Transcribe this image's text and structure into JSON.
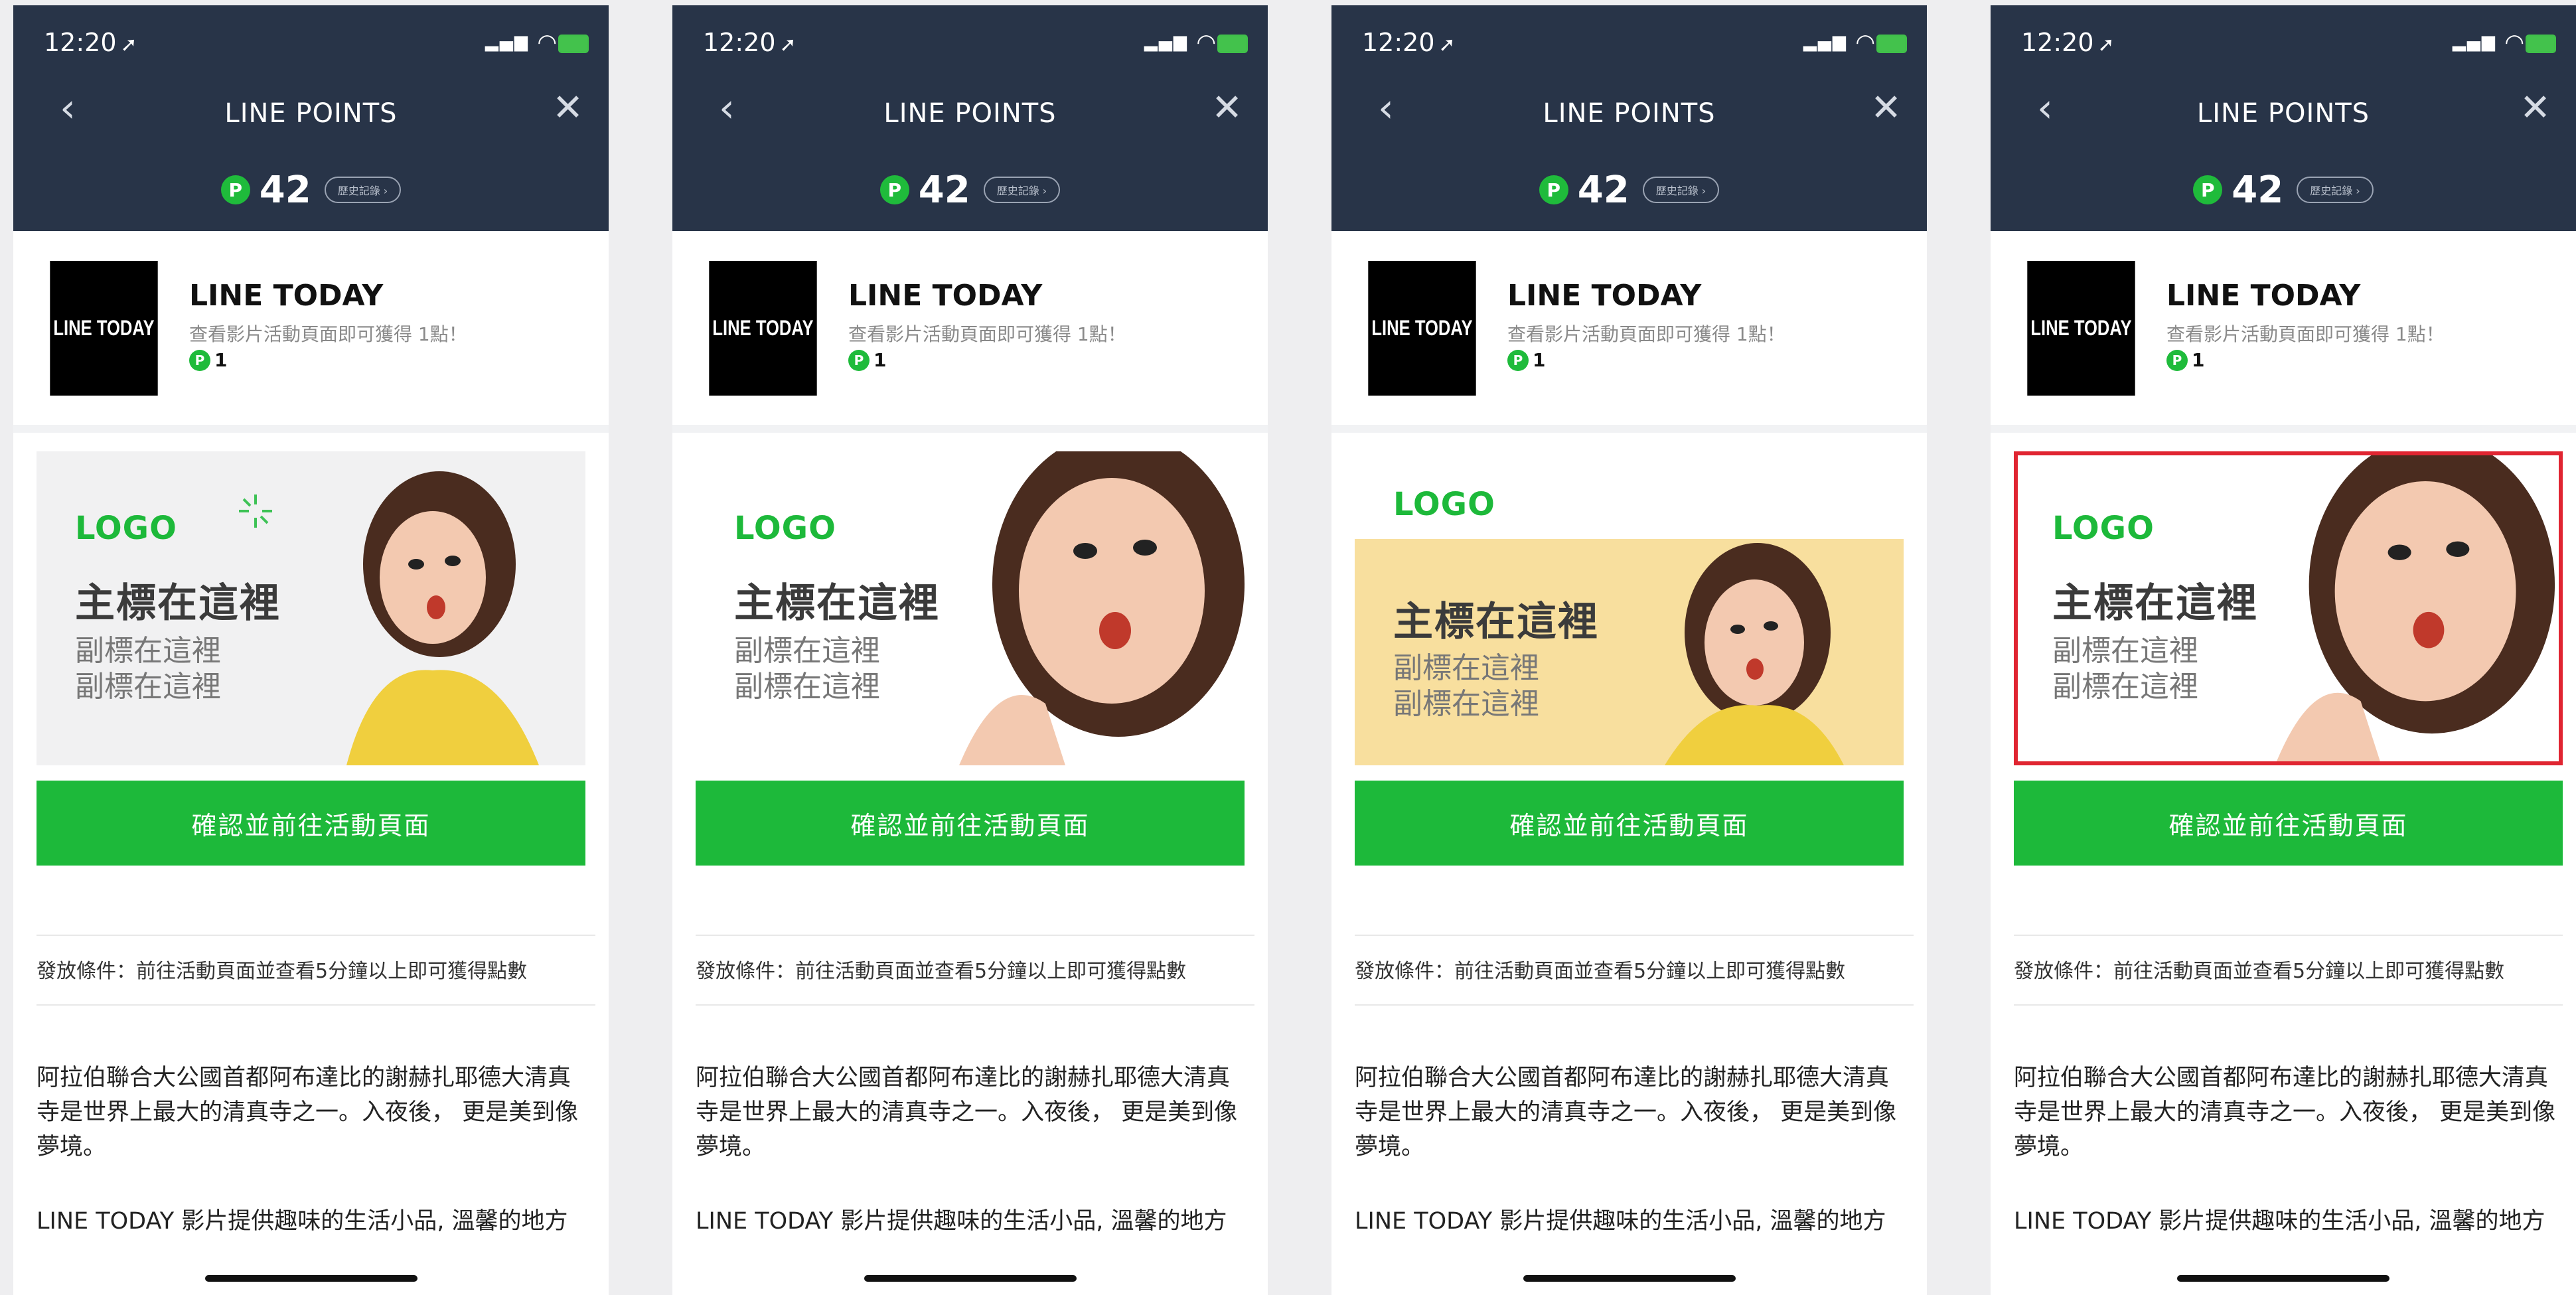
{
  "status_bar": {
    "time": "12:20"
  },
  "nav": {
    "title": "LINE POINTS",
    "back_icon": "chevron-left-icon",
    "close_icon": "close-icon"
  },
  "points": {
    "badge": "P",
    "value": "42",
    "history_label": "歷史記錄 ›"
  },
  "offer": {
    "logo_text": "LINE TODAY",
    "title": "LINE TODAY",
    "description": "查看影片活動頁面即可獲得 1點！",
    "points": "1"
  },
  "banner": {
    "logo": "LOGO",
    "headline": "主標在這裡",
    "subline1": "副標在這裡",
    "subline2": "副標在這裡"
  },
  "cta_label": "確認並前往活動頁面",
  "condition": "發放條件：前往活動頁面並查看5分鐘以上即可獲得點數",
  "body_text_1": "阿拉伯聯合大公國首都阿布達比的謝赫扎耶德大清真寺是世界上最大的清真寺之一。入夜後， 更是美到像夢境。",
  "body_text_2": "LINE TODAY 影片提供趣味的生活小品, 溫馨的地方",
  "colors": {
    "nav_bg": "#283448",
    "accent_green": "#1db93a",
    "banner_yellow": "#f8df9e",
    "selection_red": "#e02531"
  }
}
